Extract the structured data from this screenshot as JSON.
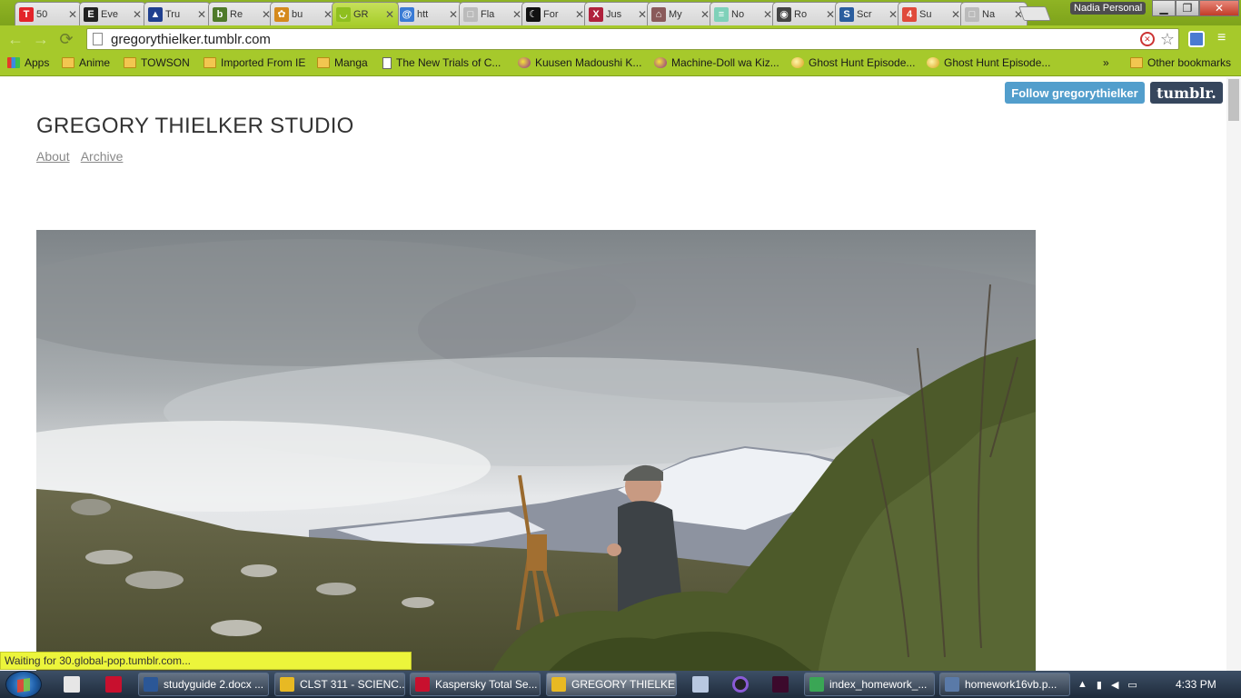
{
  "browser": {
    "tabs": [
      {
        "label": "50",
        "fav": "T",
        "fav_color": "#e3232a",
        "active": false
      },
      {
        "label": "Eve",
        "fav": "E",
        "fav_color": "#222222",
        "active": false
      },
      {
        "label": "Tru",
        "fav": "▲",
        "fav_color": "#1f3f8f",
        "active": false
      },
      {
        "label": "Re",
        "fav": "b",
        "fav_color": "#4f7a2a",
        "active": false
      },
      {
        "label": "bu",
        "fav": "✿",
        "fav_color": "#d58a1d",
        "active": false
      },
      {
        "label": "GR",
        "fav": "◡",
        "fav_color": "#8fbf1f",
        "active": true
      },
      {
        "label": "htt",
        "fav": "@",
        "fav_color": "#3a7bd5",
        "active": false
      },
      {
        "label": "Fla",
        "fav": "□",
        "fav_color": "#bbbbbb",
        "active": false
      },
      {
        "label": "For",
        "fav": "☾",
        "fav_color": "#111111",
        "active": false
      },
      {
        "label": "Jus",
        "fav": "X",
        "fav_color": "#b0213c",
        "active": false
      },
      {
        "label": "My",
        "fav": "⌂",
        "fav_color": "#8a5a5a",
        "active": false
      },
      {
        "label": "No",
        "fav": "≡",
        "fav_color": "#7fd1b9",
        "active": false
      },
      {
        "label": "Ro",
        "fav": "◉",
        "fav_color": "#444444",
        "active": false
      },
      {
        "label": "Scr",
        "fav": "S",
        "fav_color": "#2a5d9e",
        "active": false
      },
      {
        "label": "Su",
        "fav": "4",
        "fav_color": "#e04a3b",
        "active": false
      },
      {
        "label": "Na",
        "fav": "□",
        "fav_color": "#bbbbbb",
        "active": false
      }
    ],
    "tab_close": "✕",
    "profile_name": "Nadia Personal",
    "window_controls": {
      "minimize": "▁",
      "maximize": "❐",
      "close": "✕"
    },
    "nav": {
      "back": "←",
      "forward": "→",
      "reload": "⟳"
    },
    "url": "gregorythielker.tumblr.com",
    "block_icon": "✕",
    "star_icon": "☆",
    "menu_icon": "≡",
    "bookmarks": [
      {
        "label": "Apps",
        "icon": "apps-grid"
      },
      {
        "label": "Anime",
        "icon": "folder"
      },
      {
        "label": "TOWSON",
        "icon": "folder"
      },
      {
        "label": "Imported From IE",
        "icon": "folder"
      },
      {
        "label": "Manga",
        "icon": "folder"
      },
      {
        "label": "The New Trials of C...",
        "icon": "doc"
      },
      {
        "label": "Kuusen Madoushi K...",
        "icon": "ball"
      },
      {
        "label": "Machine-Doll wa Kiz...",
        "icon": "ball"
      },
      {
        "label": "Ghost Hunt Episode...",
        "icon": "ghost"
      },
      {
        "label": "Ghost Hunt Episode...",
        "icon": "ghost"
      }
    ],
    "bookmarks_overflow": "»",
    "other_bookmarks": "Other bookmarks",
    "status": "Waiting for 30.global-pop.tumblr.com..."
  },
  "page": {
    "follow_label": "Follow gregorythielker",
    "tumblr_logo": "tumblr.",
    "title": "GREGORY THIELKER STUDIO",
    "nav_links": [
      "About",
      "Archive"
    ]
  },
  "taskbar": {
    "tasks": [
      {
        "label": "studyguide 2.docx ...",
        "color": "#2b5797",
        "active": false
      },
      {
        "label": "CLST 311 - SCIENC...",
        "color": "#e8b923",
        "active": false
      },
      {
        "label": "Kaspersky Total Se...",
        "color": "#c8102e",
        "active": false
      },
      {
        "label": "GREGORY THIELKE...",
        "color": "#e8b923",
        "active": true
      },
      {
        "label": "index_homework_...",
        "color": "#3aa655",
        "active": false
      },
      {
        "label": "homework16vb.p...",
        "color": "#5a7aa8",
        "active": false
      }
    ],
    "tray_arrow": "▲",
    "clock": "4:33 PM"
  }
}
